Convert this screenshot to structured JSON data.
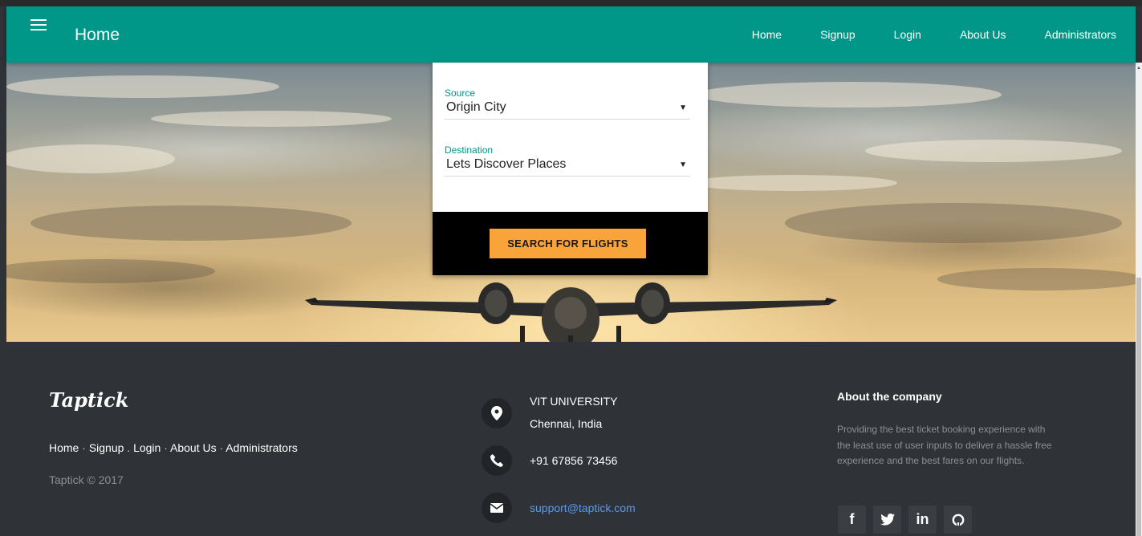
{
  "navbar": {
    "title": "Home",
    "links": [
      "Home",
      "Signup",
      "Login",
      "About Us",
      "Administrators"
    ]
  },
  "search": {
    "source_label": "Source",
    "source_value": "Origin City",
    "destination_label": "Destination",
    "destination_value": "Lets Discover Places",
    "button_label": "SEARCH FOR FLIGHTS"
  },
  "footer": {
    "logo": "Taptick",
    "links": [
      "Home",
      "Signup",
      "Login",
      "About Us",
      "Administrators"
    ],
    "copyright": "Taptick © 2017",
    "address_line1": "VIT UNIVERSITY",
    "address_line2": "Chennai, India",
    "phone": "+91 67856 73456",
    "email": "support@taptick.com",
    "about_title": "About the company",
    "about_text": "Providing the best ticket booking experience with the least use of user inputs to deliver a hassle free experience and the best fares on our flights.",
    "socials": [
      {
        "icon": "facebook-icon",
        "glyph": "f"
      },
      {
        "icon": "twitter-icon",
        "glyph": "t"
      },
      {
        "icon": "linkedin-icon",
        "glyph": "in"
      },
      {
        "icon": "github-icon",
        "glyph": "gh"
      }
    ]
  },
  "colors": {
    "primary": "#009688",
    "accent": "#f9a43a",
    "footer_bg": "#2f3236",
    "link": "#5c98f0"
  }
}
